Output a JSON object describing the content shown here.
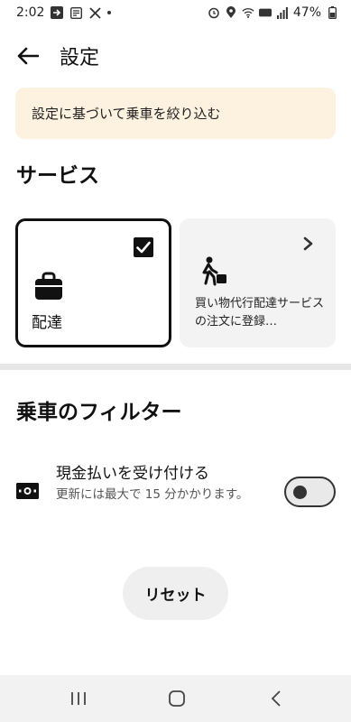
{
  "status_bar": {
    "time": "2:02",
    "battery": "47%",
    "left_icons": [
      "input-arrow-icon",
      "news-icon",
      "x-icon",
      "dot-icon"
    ],
    "right_icons": [
      "alarm-icon",
      "location-icon",
      "wifi-icon",
      "volte-icon",
      "signal-icon"
    ]
  },
  "header": {
    "title": "設定",
    "back_icon": "back-arrow-icon"
  },
  "banner": {
    "text": "設定に基づいて乗車を絞り込む",
    "background": "#fdf2df"
  },
  "services": {
    "title": "サービス",
    "cards": [
      {
        "label": "配達",
        "icon": "bag-icon",
        "selected": true
      },
      {
        "label": "買い物代行配達サービスの注文に登録…",
        "icon": "shopper-icon",
        "selected": false
      }
    ]
  },
  "filters": {
    "title": "乗車のフィルター",
    "items": [
      {
        "title": "現金払いを受け付ける",
        "subtitle": "更新には最大で 15 分かかります。",
        "icon": "cash-icon",
        "enabled": false
      }
    ]
  },
  "reset_label": "リセット",
  "nav_bar": {
    "buttons": [
      "recent-apps-icon",
      "home-icon",
      "back-nav-icon"
    ]
  },
  "colors": {
    "accent": "#111111",
    "card_inactive_bg": "#f3f3f3",
    "divider": "#e6e6e6"
  }
}
